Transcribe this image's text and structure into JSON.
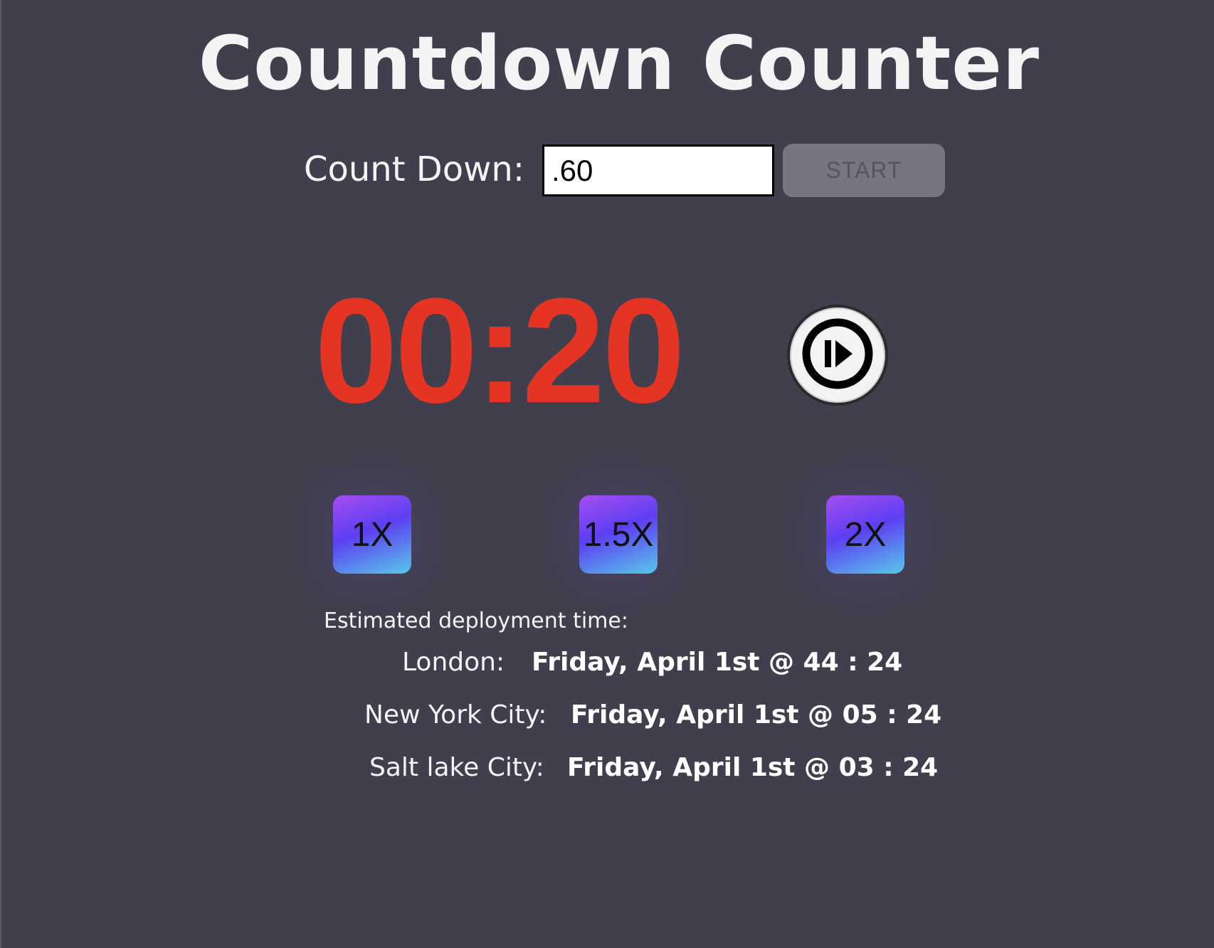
{
  "page": {
    "title": "Countdown Counter"
  },
  "countdown": {
    "label": "Count Down:",
    "input_value": ".60",
    "start_label": "START"
  },
  "timer": {
    "display": "00:20",
    "play_pause_icon": "play-pause-icon"
  },
  "speed_buttons": [
    "1X",
    "1.5X",
    "2X"
  ],
  "deployment": {
    "label": "Estimated deployment time:",
    "rows": [
      {
        "location": "London:",
        "time": "Friday, April 1st @ 44 : 24"
      },
      {
        "location": "New York City:",
        "time": "Friday, April 1st @ 05 : 24"
      },
      {
        "location": "Salt lake City:",
        "time": "Friday, April 1st @ 03 : 24"
      }
    ]
  },
  "colors": {
    "background": "#3f3f4d",
    "timer": "#e63424",
    "start_button_bg": "#767682",
    "speed_gradient_start": "#a54ef0",
    "speed_gradient_mid": "#5c3ff2",
    "speed_gradient_end": "#58c9ea"
  }
}
